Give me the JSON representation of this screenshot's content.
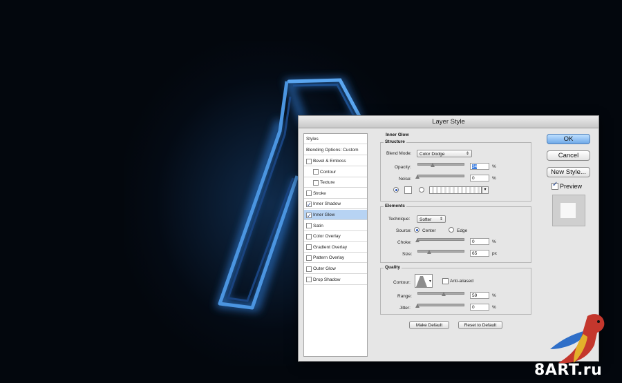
{
  "dialog": {
    "title": "Layer Style",
    "styles_header": "Styles",
    "blending_options": "Blending Options: Custom",
    "style_items": [
      {
        "label": "Bevel & Emboss",
        "checked": false
      },
      {
        "label": "Contour",
        "checked": false
      },
      {
        "label": "Texture",
        "checked": false
      },
      {
        "label": "Stroke",
        "checked": false
      },
      {
        "label": "Inner Shadow",
        "checked": true
      },
      {
        "label": "Inner Glow",
        "checked": true
      },
      {
        "label": "Satin",
        "checked": false
      },
      {
        "label": "Color Overlay",
        "checked": false
      },
      {
        "label": "Gradient Overlay",
        "checked": false
      },
      {
        "label": "Pattern Overlay",
        "checked": false
      },
      {
        "label": "Outer Glow",
        "checked": false
      },
      {
        "label": "Drop Shadow",
        "checked": false
      }
    ],
    "selected_item": "Inner Glow"
  },
  "inner_glow": {
    "title": "Inner Glow",
    "structure": {
      "title": "Structure",
      "blend_mode_label": "Blend Mode:",
      "blend_mode_value": "Color Dodge",
      "opacity_label": "Opacity:",
      "opacity_value": "34",
      "opacity_unit": "%",
      "opacity_level": 0.34,
      "noise_label": "Noise:",
      "noise_value": "0",
      "noise_unit": "%",
      "noise_level": 0.0
    },
    "elements": {
      "title": "Elements",
      "technique_label": "Technique:",
      "technique_value": "Softer",
      "source_label": "Source:",
      "source_center": "Center",
      "source_edge": "Edge",
      "source_selected": "Center",
      "choke_label": "Choke:",
      "choke_value": "0",
      "choke_unit": "%",
      "choke_level": 0.0,
      "size_label": "Size:",
      "size_value": "65",
      "size_unit": "px",
      "size_level": 0.26
    },
    "quality": {
      "title": "Quality",
      "contour_label": "Contour:",
      "anti_aliased_label": "Anti-aliased",
      "anti_aliased_checked": false,
      "range_label": "Range:",
      "range_value": "59",
      "range_unit": "%",
      "range_level": 0.59,
      "jitter_label": "Jitter:",
      "jitter_value": "0",
      "jitter_unit": "%",
      "jitter_level": 0.0
    },
    "make_default": "Make Default",
    "reset_default": "Reset to Default"
  },
  "buttons": {
    "ok": "OK",
    "cancel": "Cancel",
    "new_style": "New Style...",
    "preview_label": "Preview",
    "preview_checked": true
  },
  "watermark": "8ART.ru",
  "colors": {
    "glow": "#3f8fe0",
    "selection": "#b7d3f3",
    "ok_button": "#6fa9e8"
  }
}
